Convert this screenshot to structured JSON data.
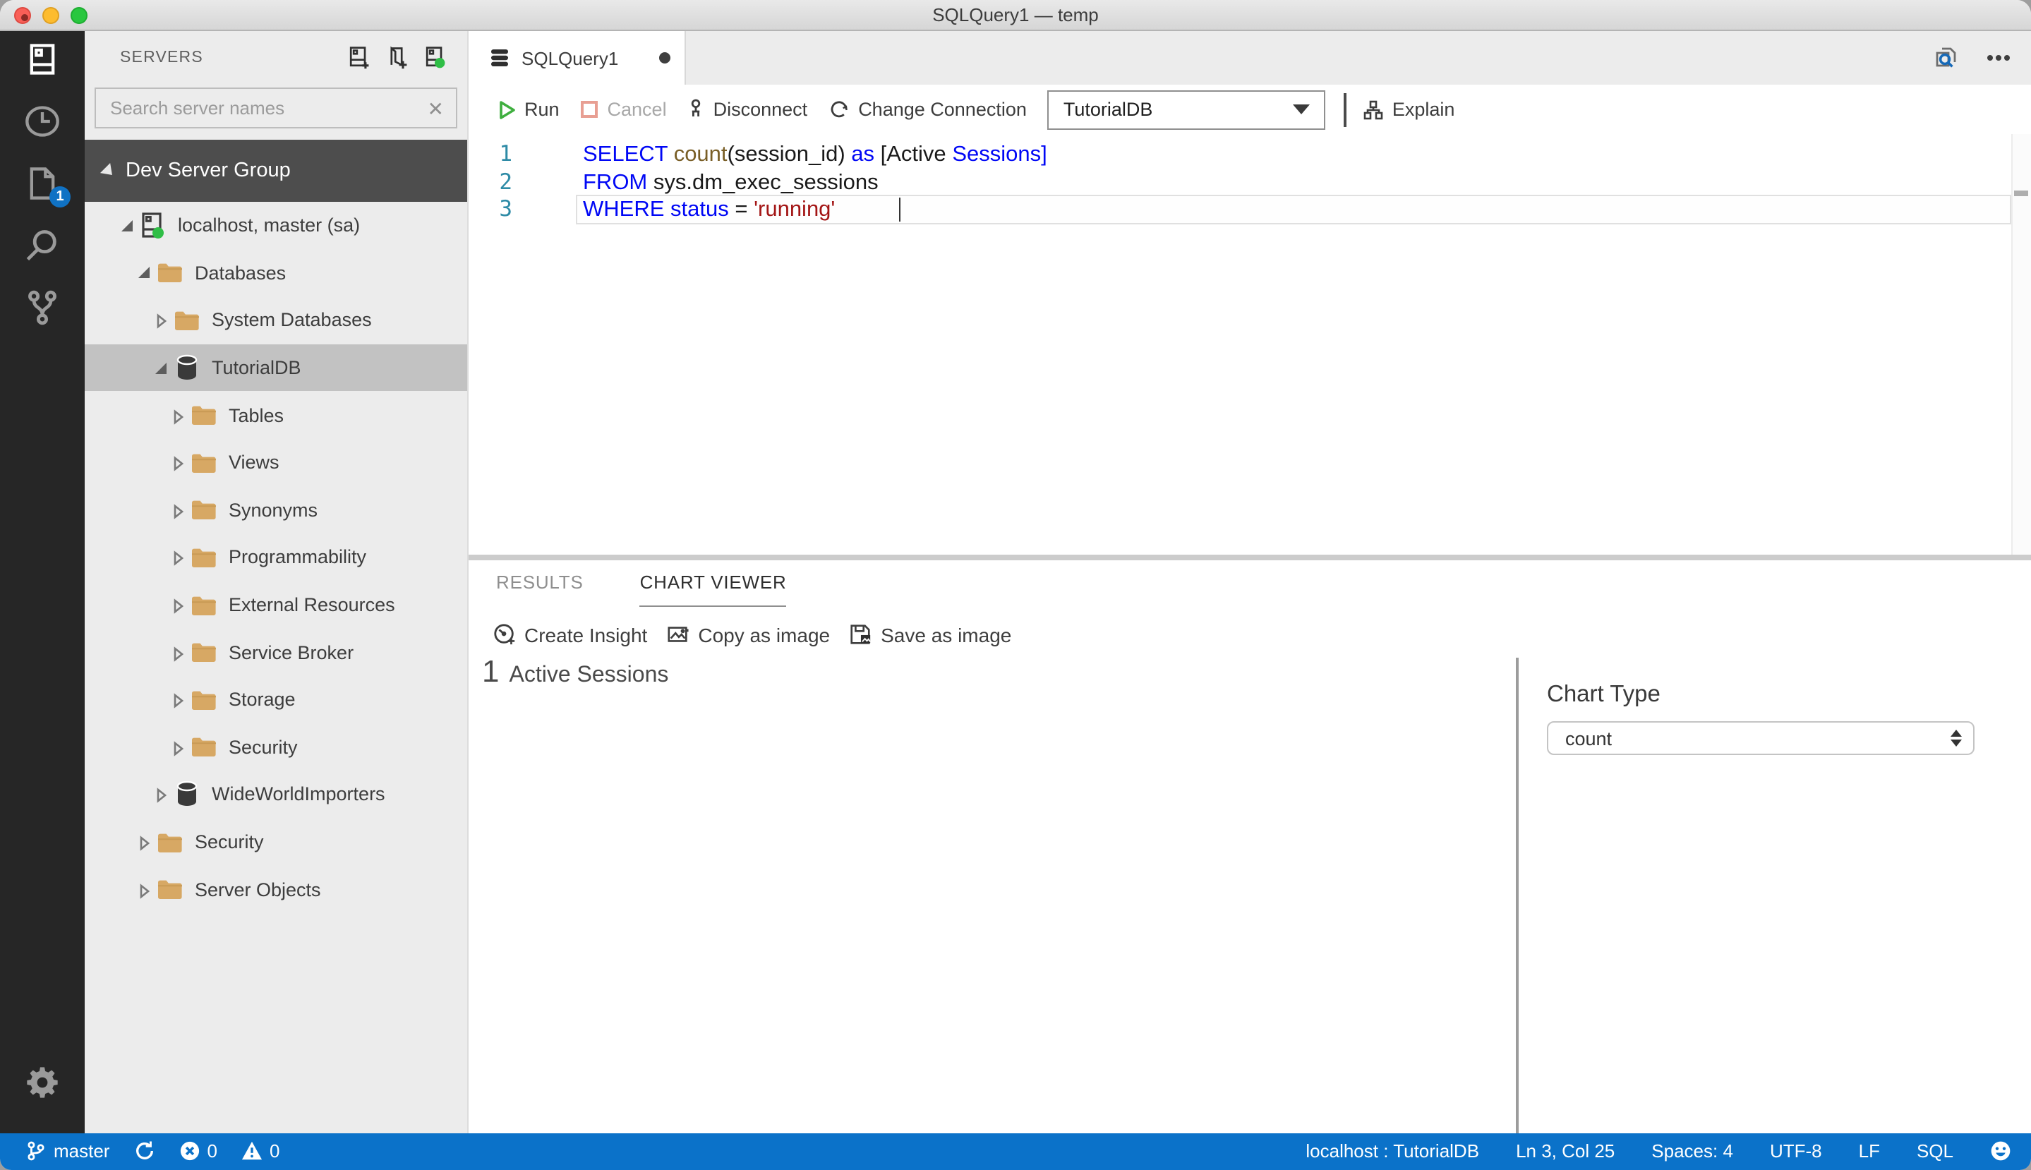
{
  "window": {
    "title": "SQLQuery1 — temp"
  },
  "activity_bar": {
    "items": [
      {
        "name": "connections",
        "icon": "server-icon",
        "active": true,
        "badge": ""
      },
      {
        "name": "task-history",
        "icon": "clock-icon",
        "active": false,
        "badge": ""
      },
      {
        "name": "open-editors",
        "icon": "file-icon",
        "active": false,
        "badge": "1"
      },
      {
        "name": "search",
        "icon": "search-icon",
        "active": false,
        "badge": ""
      },
      {
        "name": "source-control",
        "icon": "git-branch-icon",
        "active": false,
        "badge": ""
      }
    ],
    "bottom": {
      "name": "settings",
      "icon": "gear-icon"
    }
  },
  "sidebar": {
    "title": "SERVERS",
    "actions": [
      {
        "name": "new-connection",
        "icon": "server-add-icon"
      },
      {
        "name": "new-server-group",
        "icon": "group-add-icon"
      },
      {
        "name": "active-connections",
        "icon": "server-active-icon"
      }
    ],
    "search": {
      "placeholder": "Search server names",
      "value": ""
    },
    "group": {
      "label": "Dev Server Group"
    },
    "tree": [
      {
        "label": "localhost, master (sa)",
        "level": 1,
        "icon": "server",
        "state": "expanded",
        "selected": false
      },
      {
        "label": "Databases",
        "level": 2,
        "icon": "folder",
        "state": "expanded",
        "selected": false
      },
      {
        "label": "System Databases",
        "level": 3,
        "icon": "folder",
        "state": "collapsed",
        "selected": false
      },
      {
        "label": "TutorialDB",
        "level": 3,
        "icon": "database",
        "state": "expanded",
        "selected": true
      },
      {
        "label": "Tables",
        "level": 4,
        "icon": "folder",
        "state": "collapsed",
        "selected": false
      },
      {
        "label": "Views",
        "level": 4,
        "icon": "folder",
        "state": "collapsed",
        "selected": false
      },
      {
        "label": "Synonyms",
        "level": 4,
        "icon": "folder",
        "state": "collapsed",
        "selected": false
      },
      {
        "label": "Programmability",
        "level": 4,
        "icon": "folder",
        "state": "collapsed",
        "selected": false
      },
      {
        "label": "External Resources",
        "level": 4,
        "icon": "folder",
        "state": "collapsed",
        "selected": false
      },
      {
        "label": "Service Broker",
        "level": 4,
        "icon": "folder",
        "state": "collapsed",
        "selected": false
      },
      {
        "label": "Storage",
        "level": 4,
        "icon": "folder",
        "state": "collapsed",
        "selected": false
      },
      {
        "label": "Security",
        "level": 4,
        "icon": "folder",
        "state": "collapsed",
        "selected": false
      },
      {
        "label": "WideWorldImporters",
        "level": 3,
        "icon": "database",
        "state": "collapsed",
        "selected": false
      },
      {
        "label": "Security",
        "level": 2,
        "icon": "folder",
        "state": "collapsed",
        "selected": false
      },
      {
        "label": "Server Objects",
        "level": 2,
        "icon": "folder",
        "state": "collapsed",
        "selected": false
      }
    ]
  },
  "editor": {
    "tab": {
      "label": "SQLQuery1",
      "dirty": true
    },
    "toolbar": {
      "run": "Run",
      "cancel": "Cancel",
      "disconnect": "Disconnect",
      "change_connection": "Change Connection",
      "database": "TutorialDB",
      "explain": "Explain"
    },
    "lines": [
      {
        "num": "1",
        "tokens": [
          {
            "t": "SELECT",
            "c": "kw"
          },
          {
            "t": " ",
            "c": "p"
          },
          {
            "t": "count",
            "c": "fn"
          },
          {
            "t": "(session_id) ",
            "c": "p"
          },
          {
            "t": "as",
            "c": "kw"
          },
          {
            "t": " [Active ",
            "c": "p"
          },
          {
            "t": "Sessions]",
            "c": "kw"
          }
        ]
      },
      {
        "num": "2",
        "tokens": [
          {
            "t": "FROM",
            "c": "kw"
          },
          {
            "t": " sys.dm_exec_sessions",
            "c": "p"
          }
        ]
      },
      {
        "num": "3",
        "current": true,
        "tokens": [
          {
            "t": "WHERE",
            "c": "kw"
          },
          {
            "t": " ",
            "c": "p"
          },
          {
            "t": "status",
            "c": "kw"
          },
          {
            "t": " = ",
            "c": "p"
          },
          {
            "t": "'running'",
            "c": "str"
          }
        ]
      }
    ]
  },
  "panel": {
    "tabs": [
      {
        "label": "RESULTS",
        "active": false
      },
      {
        "label": "CHART VIEWER",
        "active": true
      }
    ],
    "actions": [
      {
        "name": "create-insight",
        "icon": "insight-icon",
        "label": "Create Insight"
      },
      {
        "name": "copy-as-image",
        "icon": "image-icon",
        "label": "Copy as image"
      },
      {
        "name": "save-as-image",
        "icon": "save-image-icon",
        "label": "Save as image"
      }
    ],
    "insight": {
      "value": "1",
      "label": "Active Sessions"
    },
    "chart_type": {
      "label": "Chart Type",
      "value": "count"
    }
  },
  "status_bar": {
    "left": [
      {
        "name": "git-branch",
        "icon": "branch-icon",
        "label": "master"
      },
      {
        "name": "sync",
        "icon": "sync-icon",
        "label": ""
      },
      {
        "name": "errors",
        "icon": "error-icon",
        "label": "0"
      },
      {
        "name": "warnings",
        "icon": "warning-icon",
        "label": "0"
      }
    ],
    "right": [
      {
        "name": "connection",
        "label": "localhost : TutorialDB"
      },
      {
        "name": "cursor-position",
        "label": "Ln 3, Col 25"
      },
      {
        "name": "indentation",
        "label": "Spaces: 4"
      },
      {
        "name": "encoding",
        "label": "UTF-8"
      },
      {
        "name": "eol",
        "label": "LF"
      },
      {
        "name": "language-mode",
        "label": "SQL"
      },
      {
        "name": "feedback",
        "icon": "smiley-icon",
        "label": ""
      }
    ]
  },
  "colors": {
    "status_bar": "#0b72c9",
    "activity_bar": "#262626",
    "sidebar": "#ececec",
    "group_header": "#4d4d4d",
    "selection": "#c2c2c2",
    "folder": "#d7a864",
    "connected_dot": "#2fbe46",
    "keyword": "#0007f5",
    "function": "#795e26",
    "string": "#a31515",
    "line_number": "#2e8ba6",
    "run_green": "#3faf3f",
    "cancel_red": "#e89f93",
    "badge_blue": "#1072c4"
  }
}
